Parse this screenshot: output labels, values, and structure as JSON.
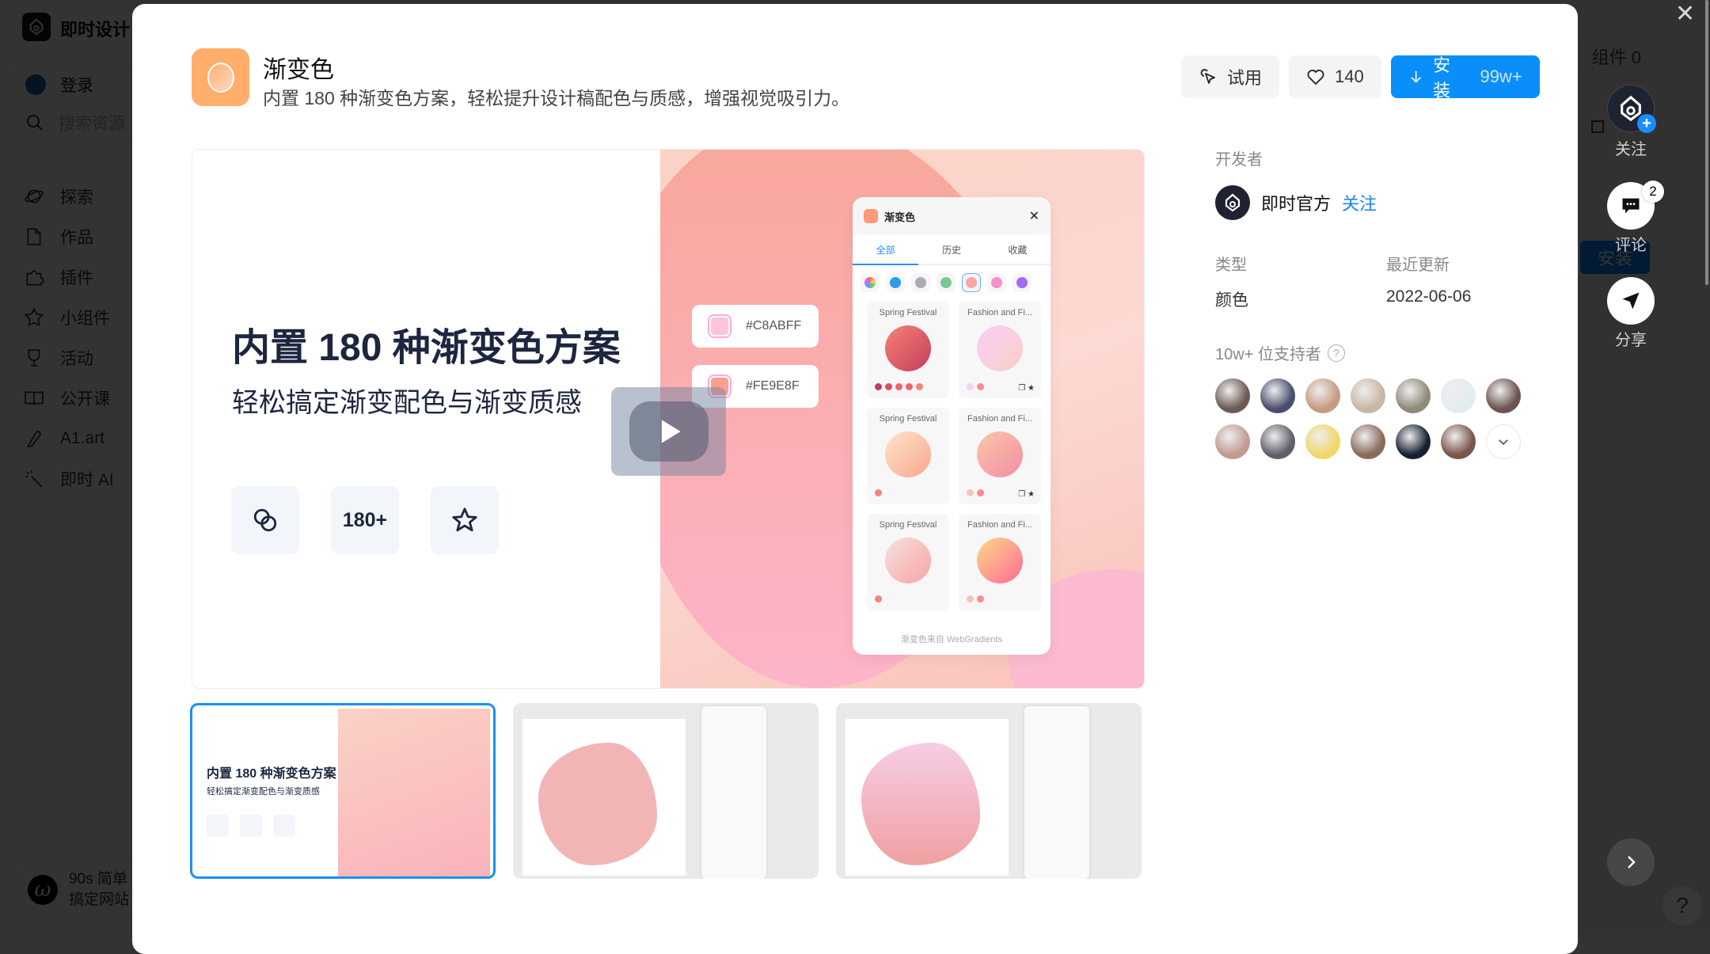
{
  "background": {
    "brand": "即时设计",
    "login": "登录",
    "search_placeholder": "搜索资源",
    "nav": [
      {
        "icon": "planet-icon",
        "label": "探索"
      },
      {
        "icon": "file-icon",
        "label": "作品"
      },
      {
        "icon": "puzzle-icon",
        "label": "插件"
      },
      {
        "icon": "widget-star-icon",
        "label": "小组件"
      },
      {
        "icon": "trophy-icon",
        "label": "活动"
      },
      {
        "icon": "book-icon",
        "label": "公开课"
      },
      {
        "icon": "pen-icon",
        "label": "A1.art"
      },
      {
        "icon": "magic-wand-icon",
        "label": "即时 AI"
      }
    ],
    "promo": {
      "line1": "90s 简单",
      "line2": "搞定网站"
    },
    "widget_count": "组件 0",
    "install_label": "安装"
  },
  "plugin": {
    "name": "渐变色",
    "description": "内置 180 种渐变色方案，轻松提升设计稿配色与质感，增强视觉吸引力。",
    "icon_color": "#FFAE6C"
  },
  "actions": {
    "try_label": "试用",
    "like_count": "140",
    "install_label": "安装",
    "install_count": "99w+",
    "accent": "#0A8FFA"
  },
  "preview": {
    "headline": "内置 180 种渐变色方案",
    "subhead": "轻松搞定渐变配色与渐变质感",
    "tile_count": "180+",
    "hex_chips": [
      {
        "hex": "#C8ABFF",
        "swatch": "#FFC4D9"
      },
      {
        "hex": "#FE9E8F",
        "swatch": "#FE9E8F"
      }
    ],
    "mini_panel": {
      "title": "渐变色",
      "close": "✕",
      "tabs": [
        "全部",
        "历史",
        "收藏"
      ],
      "active_tab": 0,
      "color_filters": [
        "rainbow",
        "#2B9BEF",
        "#A9ADB2",
        "#7AC993",
        "#F9A8A4",
        "#F68FCB",
        "#A46BF5"
      ],
      "selected_filter": 4,
      "cards": [
        {
          "name": "Spring Festival",
          "gradient": [
            "#F88274",
            "#C33E5E"
          ],
          "dots": [
            "#C33E5E",
            "#E24A60",
            "#F2636A",
            "#F2636A",
            "#F88274"
          ]
        },
        {
          "name": "Fashion and Fi...",
          "gradient": [
            "#FBCDF7",
            "#F8D0C7"
          ],
          "dots": [
            "#FBCDF7",
            "#F98C8C"
          ],
          "actions": true
        },
        {
          "name": "Spring Festival",
          "gradient": [
            "#FDE3CB",
            "#F9A88E"
          ],
          "dots": [
            "#F88274"
          ]
        },
        {
          "name": "Fashion and Fi...",
          "gradient": [
            "#FAC6A7",
            "#F48EA5"
          ],
          "dots": [
            "#F8C4B8",
            "#F98C8C"
          ],
          "actions": true
        },
        {
          "name": "Spring Festival",
          "gradient": [
            "#F5E1E1",
            "#FAA4A2"
          ],
          "dots": [
            "#F88274"
          ]
        },
        {
          "name": "Fashion and Fi...",
          "gradient": [
            "#FDD889",
            "#FE6B93"
          ],
          "dots": [
            "#F8C4B8",
            "#F98C8C"
          ]
        }
      ],
      "footer": "渐变色来自 WebGradients"
    }
  },
  "thumbnails": [
    {
      "active": true,
      "headline": "内置 180 种渐变色方案",
      "subhead": "轻松搞定渐变配色与渐变质感"
    },
    {
      "active": false,
      "blob_color": "#F1B5B5"
    },
    {
      "active": false,
      "blob_color": "#F3B9CC"
    }
  ],
  "info": {
    "developer_label": "开发者",
    "developer_name": "即时官方",
    "follow_label": "关注",
    "type_label": "类型",
    "type_value": "颜色",
    "updated_label": "最近更新",
    "updated_value": "2022-06-06",
    "supporters_label": "10w+ 位支持者",
    "supporter_avatars": [
      "#6b5a55",
      "#4a4e6e",
      "#c79a82",
      "#c9b6a3",
      "#8f8a7a",
      "#e3edf1",
      "#6b5350",
      "#c29a90",
      "#5d6068",
      "#f3d66a",
      "#8a6a5a",
      "#152030",
      "#7a5548"
    ]
  },
  "floating": {
    "follow_label": "关注",
    "comment_label": "评论",
    "comment_count": "2",
    "share_label": "分享",
    "close": "✕",
    "help": "?"
  }
}
